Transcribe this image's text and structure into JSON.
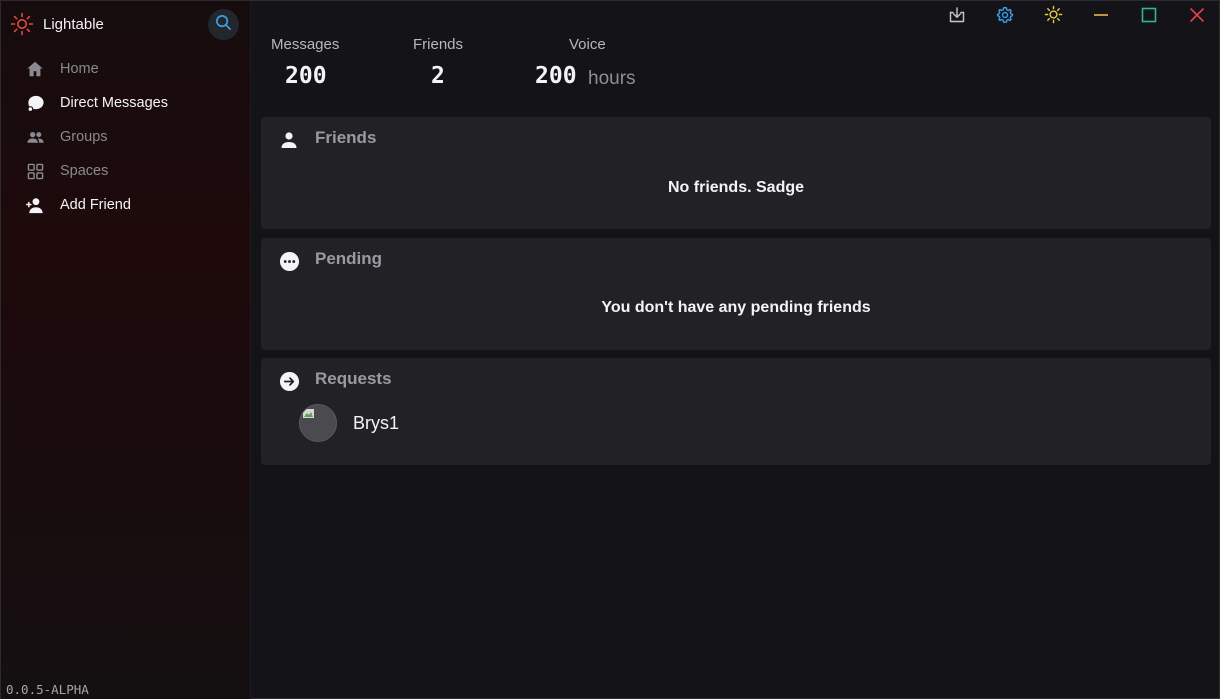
{
  "app": {
    "title": "Lightable",
    "version": "0.0.5-ALPHA"
  },
  "sidebar": {
    "items": [
      {
        "label": "Home",
        "icon": "home-icon"
      },
      {
        "label": "Direct Messages",
        "icon": "chat-icon"
      },
      {
        "label": "Groups",
        "icon": "groups-icon"
      },
      {
        "label": "Spaces",
        "icon": "spaces-icon"
      },
      {
        "label": "Add Friend",
        "icon": "add-friend-icon"
      }
    ]
  },
  "stats": {
    "messages": {
      "label": "Messages",
      "value": "200"
    },
    "friends": {
      "label": "Friends",
      "value": "2"
    },
    "voice": {
      "label": "Voice",
      "value": "200",
      "unit": "hours"
    }
  },
  "panels": {
    "friends": {
      "title": "Friends",
      "message": "No friends. Sadge"
    },
    "pending": {
      "title": "Pending",
      "message": "You don't have any pending friends"
    },
    "requests": {
      "title": "Requests",
      "items": [
        {
          "name": "Brys1"
        }
      ]
    }
  },
  "colors": {
    "accent_red": "#e24a3b",
    "search_blue": "#3aa0e0",
    "settings_blue": "#3a9be8",
    "theme_yellow": "#e8c94a",
    "minimize_yellow": "#e8b84a",
    "maximize_green": "#2fb59a",
    "close_red": "#e0414a"
  }
}
